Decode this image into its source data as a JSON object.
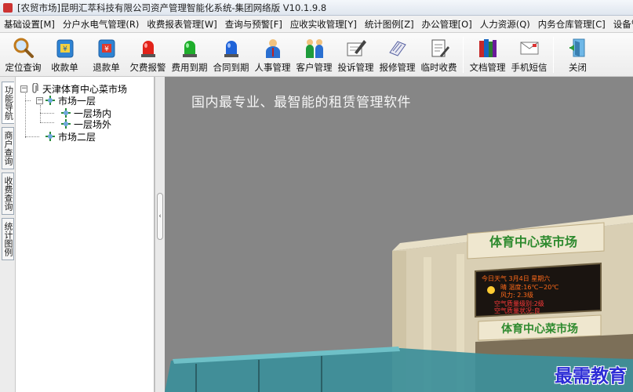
{
  "window": {
    "title": "[农贸市场]昆明汇萃科技有限公司资产管理智能化系统-集团网络版 V10.1.9.8"
  },
  "menu": [
    "基础设置[M]",
    "分户水电气管理(R)",
    "收费报表管理[W]",
    "查询与预警[F]",
    "应收实收管理[Y]",
    "统计图例[Z]",
    "办公管理[O]",
    "人力资源(Q)",
    "内务仓库管理[C]",
    "设备管"
  ],
  "toolbar": [
    {
      "label": "定位查询",
      "icon": "magnifier-icon"
    },
    {
      "label": "收款单",
      "icon": "receipt-icon"
    },
    {
      "label": "退款单",
      "icon": "refund-icon"
    },
    {
      "label": "欠费报警",
      "icon": "red-alarm-icon"
    },
    {
      "label": "费用到期",
      "icon": "green-alarm-icon"
    },
    {
      "label": "合同到期",
      "icon": "blue-alarm-icon"
    },
    {
      "label": "人事管理",
      "icon": "person-icon"
    },
    {
      "label": "客户管理",
      "icon": "people-icon"
    },
    {
      "label": "投诉管理",
      "icon": "pen-icon"
    },
    {
      "label": "报修管理",
      "icon": "repair-icon"
    },
    {
      "label": "临时收费",
      "icon": "notepad-icon"
    },
    {
      "label": "文档管理",
      "icon": "books-icon"
    },
    {
      "label": "手机短信",
      "icon": "sms-icon"
    },
    {
      "label": "关闭",
      "icon": "exit-icon"
    }
  ],
  "side_tabs": [
    "功能导航",
    "商户查询",
    "收费查询",
    "统计图例"
  ],
  "tree": {
    "root": "天津体育中心菜市场",
    "floor1": "市场一层",
    "floor1_in": "一层场内",
    "floor1_out": "一层场外",
    "floor2": "市场二层"
  },
  "main": {
    "slogan": "国内最专业、最智能的租赁管理软件",
    "sign_top": "体育中心菜市场",
    "sign_bottom": "体育中心菜市场",
    "led_line1": "今日天气 3月4日 星期六",
    "led_line2": "晴 温度:16℃~20℃",
    "led_line3": "风力: 2.3级",
    "led_line4": "空气质量级别:2级",
    "led_line5": "空气质量状况:良"
  },
  "watermark": "最需教育"
}
